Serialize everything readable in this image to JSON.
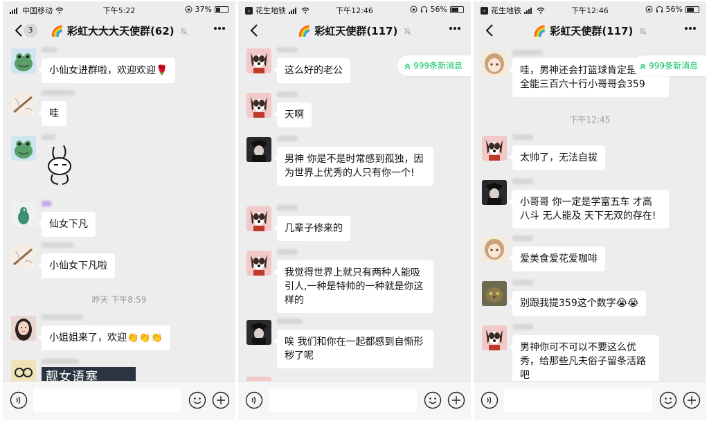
{
  "colors": {
    "accent": "#07c160",
    "bg": "#ededed",
    "bubble": "#ffffff",
    "timestamp": "#9a9a9a"
  },
  "screens": [
    {
      "status": {
        "carrier": "中国移动",
        "time": "下午5:22",
        "battery": "37%"
      },
      "nav": {
        "title": "🌈 彩虹大大大天使群(62)",
        "unread_badge": "3"
      },
      "chat": {
        "messages": [
          {
            "text": "小仙女进群啦，欢迎欢迎🌹"
          },
          {
            "text": "哇"
          },
          {
            "text": ""
          },
          {
            "text": "仙女下凡"
          },
          {
            "text": "小仙女下凡啦"
          },
          {
            "text": "小姐姐来了，欢迎👏👏👏"
          }
        ],
        "timestamp": "昨天 下午8:59",
        "image_caption": "靓女语塞"
      }
    },
    {
      "status": {
        "carrier": "花生地铁",
        "time": "下午12:46",
        "battery": "56%"
      },
      "nav": {
        "title": "🌈 彩虹天使群(117)"
      },
      "new_messages": "999条新消息",
      "chat": {
        "messages": [
          {
            "text": "这么好的老公"
          },
          {
            "text": "天啊"
          },
          {
            "text": "男神 你是不是时常感到孤独，因为世界上优秀的人只有你一个!"
          },
          {
            "text": "几辈子修来的"
          },
          {
            "text": "我觉得世界上就只有两种人能吸引人,一种是特帅的一种就是你这样的"
          },
          {
            "text": "唉 我们和你在一起都感到自惭形秽了呢"
          }
        ]
      }
    },
    {
      "status": {
        "carrier": "花生地铁",
        "time": "下午12:46",
        "battery": "56%"
      },
      "nav": {
        "title": "🌈 彩虹天使群(117)"
      },
      "new_messages": "999条新消息",
      "chat": {
        "messages": [
          {
            "text": "哇，男神还会打篮球肯定是万能全能三百六十行小哥哥会359"
          },
          {
            "text": "太帅了，无法自拔"
          },
          {
            "text": "小哥哥 你一定是学富五车 才高八斗 无人能及 天下无双的存在!"
          },
          {
            "text": "爱美食爱花爱咖啡"
          },
          {
            "text": "别跟我提359这个数字😭😭"
          },
          {
            "text": "男神你可不可以不要这么优秀，给那些凡夫俗子留条活路吧"
          }
        ],
        "timestamp": "下午12:45"
      }
    }
  ]
}
